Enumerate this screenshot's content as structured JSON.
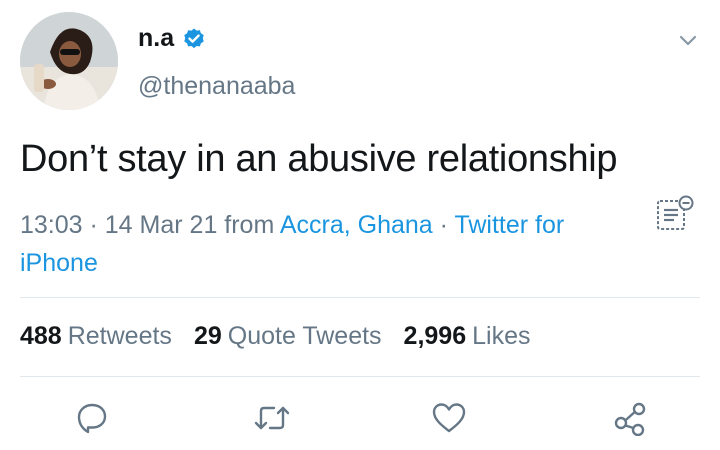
{
  "user": {
    "display_name": "n.a",
    "handle": "@thenanaaba",
    "verified": true
  },
  "tweet": {
    "text": "Don’t stay in an abusive relationship"
  },
  "meta": {
    "time": "13:03",
    "separator1": " · ",
    "date": "14 Mar 21",
    "from_label": " from ",
    "location": "Accra, Ghana",
    "separator2": " · ",
    "source": "Twitter for iPhone"
  },
  "stats": {
    "retweets_count": "488",
    "retweets_label": "Retweets",
    "quotes_count": "29",
    "quotes_label": "Quote Tweets",
    "likes_count": "2,996",
    "likes_label": "Likes"
  },
  "icons": {
    "verified": "verified-badge-icon",
    "caret": "chevron-down-icon",
    "translate": "translate-icon",
    "reply": "reply-icon",
    "retweet": "retweet-icon",
    "like": "heart-icon",
    "share": "share-icon"
  },
  "colors": {
    "accent": "#1b95e0",
    "secondary_text": "#657786",
    "primary_text": "#14171a",
    "divider": "#e1e8ed"
  }
}
